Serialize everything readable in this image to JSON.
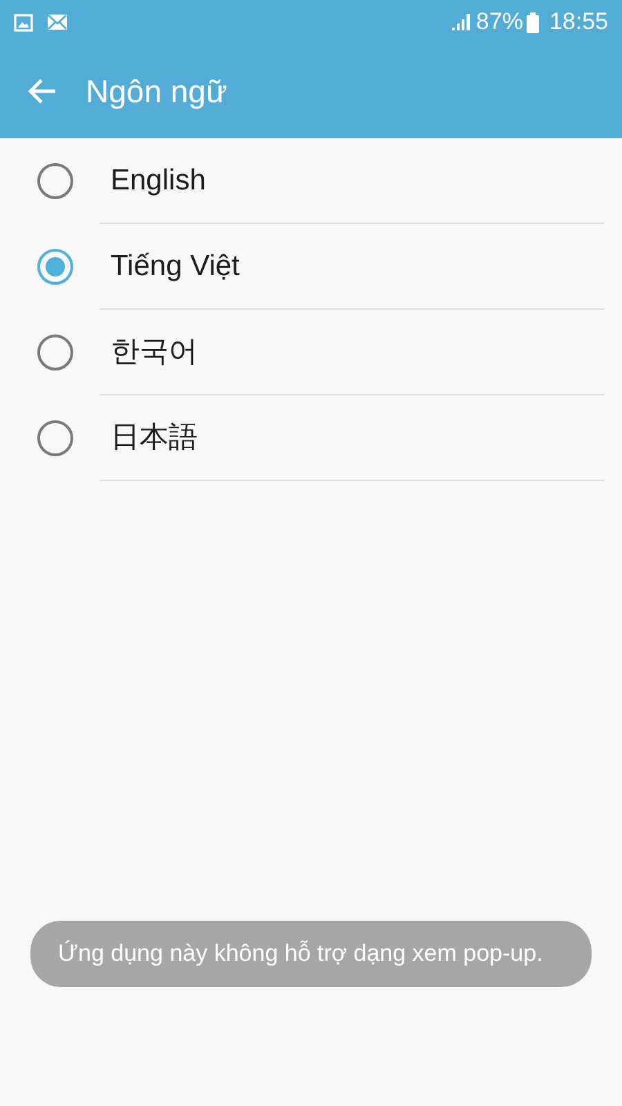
{
  "status_bar": {
    "battery": "87%",
    "time": "18:55"
  },
  "app_bar": {
    "title": "Ngôn ngữ"
  },
  "languages": [
    {
      "label": "English",
      "selected": false
    },
    {
      "label": "Tiếng Việt",
      "selected": true
    },
    {
      "label": "한국어",
      "selected": false
    },
    {
      "label": "日本語",
      "selected": false
    }
  ],
  "toast": {
    "message": "Ứng dụng này không hỗ trợ dạng xem pop-up."
  }
}
